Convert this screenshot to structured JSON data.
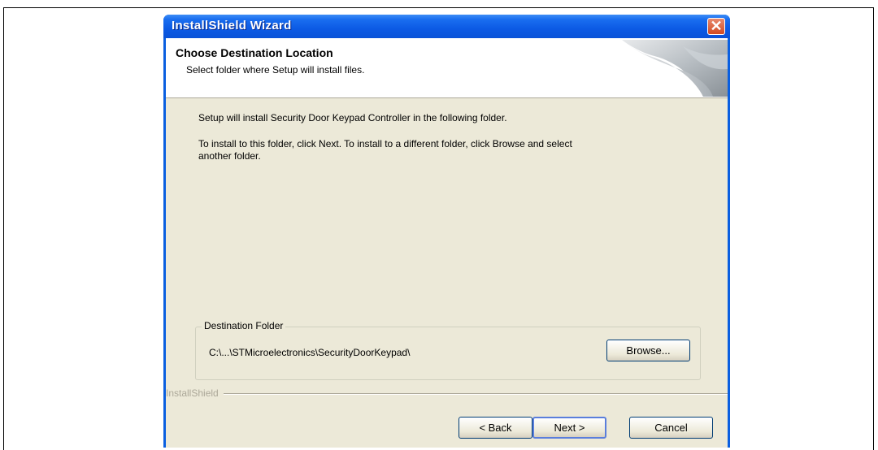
{
  "window": {
    "title": "InstallShield Wizard",
    "close_glyph": "✕"
  },
  "header": {
    "title": "Choose Destination Location",
    "subtitle": "Select folder where Setup will install files."
  },
  "body": {
    "line1": "Setup will install Security Door Keypad Controller in the following folder.",
    "line2": "To install to this folder, click Next. To install to a different folder, click Browse and select",
    "line3": "another folder."
  },
  "destination": {
    "legend": "Destination Folder",
    "path": "C:\\...\\STMicroelectronics\\SecurityDoorKeypad\\",
    "browse_label": "Browse..."
  },
  "brand": "InstallShield",
  "buttons": {
    "back": "< Back",
    "next": "Next >",
    "cancel": "Cancel"
  },
  "colors": {
    "titlebar": "#0a5fe0",
    "client_bg": "#ece9d8",
    "close_button": "#d24a22"
  }
}
